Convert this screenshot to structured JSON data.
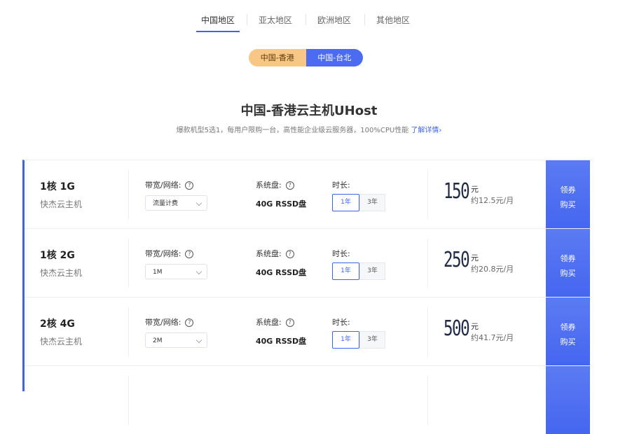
{
  "region_tabs": [
    "中国地区",
    "亚太地区",
    "欧洲地区",
    "其他地区"
  ],
  "sub_regions": [
    "中国-香港",
    "中国-台北"
  ],
  "title": "中国-香港云主机UHost",
  "subtitle": "爆款机型5选1，每用户限购一台，高性能企业级云服务器，100%CPU性能",
  "subtitle_link": "了解详情",
  "subtitle_link_arrow": "›",
  "labels": {
    "bandwidth": "带宽/网络:",
    "disk": "系统盘:",
    "duration": "时长:",
    "help": "?"
  },
  "colors": {
    "accent": "#3e63e8",
    "hk_tab": "#f8c685",
    "tw_tab": "#4b6cf1"
  },
  "products": [
    {
      "spec": "1核 1G",
      "family": "快杰云主机",
      "bandwidth_value": "流量计费",
      "disk": "40G RSSD盘",
      "durations": [
        "1年",
        "3年"
      ],
      "price": "150",
      "currency": "元",
      "monthly": "约12.5元/月",
      "buy_line1": "领券",
      "buy_line2": "购买"
    },
    {
      "spec": "1核 2G",
      "family": "快杰云主机",
      "bandwidth_value": "1M",
      "disk": "40G RSSD盘",
      "durations": [
        "1年",
        "3年"
      ],
      "price": "250",
      "currency": "元",
      "monthly": "约20.8元/月",
      "buy_line1": "领券",
      "buy_line2": "购买"
    },
    {
      "spec": "2核 4G",
      "family": "快杰云主机",
      "bandwidth_value": "2M",
      "disk": "40G RSSD盘",
      "durations": [
        "1年",
        "3年"
      ],
      "price": "500",
      "currency": "元",
      "monthly": "约41.7元/月",
      "buy_line1": "领券",
      "buy_line2": "购买"
    }
  ]
}
